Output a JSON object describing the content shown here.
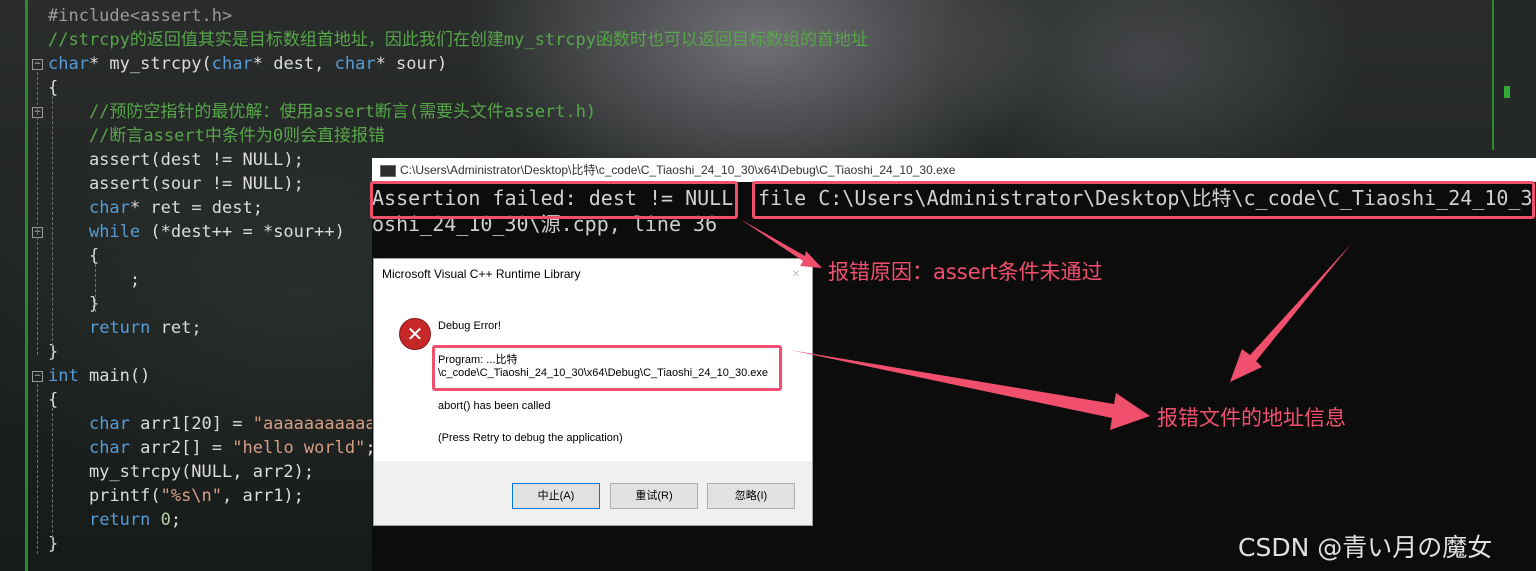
{
  "editor": {
    "lines": [
      [
        {
          "t": "#include<assert.h>",
          "c": "pp"
        }
      ],
      [
        {
          "t": "//strcpy的返回值其实是目标数组首地址，因此我们在创建my_strcpy函数时也可以返回目标数组的首地址",
          "c": "cm"
        }
      ],
      [
        {
          "t": "char",
          "c": "kw"
        },
        {
          "t": "* my_strcpy(",
          "c": "id"
        },
        {
          "t": "char",
          "c": "kw"
        },
        {
          "t": "* dest, ",
          "c": "id"
        },
        {
          "t": "char",
          "c": "kw"
        },
        {
          "t": "* sour)",
          "c": "id"
        }
      ],
      [
        {
          "t": "{",
          "c": "id"
        }
      ],
      [
        {
          "t": "    //预防空指针的最优解：使用assert断言(需要头文件assert.h)",
          "c": "cm"
        }
      ],
      [
        {
          "t": "    //断言assert中条件为0则会直接报错",
          "c": "cm"
        }
      ],
      [
        {
          "t": "    assert(dest != NULL);",
          "c": "id"
        }
      ],
      [
        {
          "t": "    assert(sour != NULL);",
          "c": "id"
        }
      ],
      [
        {
          "t": "    ",
          "c": "id"
        },
        {
          "t": "char",
          "c": "kw"
        },
        {
          "t": "* ret = dest;",
          "c": "id"
        }
      ],
      [
        {
          "t": "    ",
          "c": "id"
        },
        {
          "t": "while",
          "c": "kw"
        },
        {
          "t": " (*dest++ = *sour++)",
          "c": "id"
        }
      ],
      [
        {
          "t": "    {",
          "c": "id"
        }
      ],
      [
        {
          "t": "        ;",
          "c": "id"
        }
      ],
      [
        {
          "t": "    }",
          "c": "id"
        }
      ],
      [
        {
          "t": "    ",
          "c": "id"
        },
        {
          "t": "return",
          "c": "kw"
        },
        {
          "t": " ret;",
          "c": "id"
        }
      ],
      [
        {
          "t": "}",
          "c": "id"
        }
      ],
      [
        {
          "t": "int",
          "c": "kw"
        },
        {
          "t": " main()",
          "c": "id"
        }
      ],
      [
        {
          "t": "{",
          "c": "id"
        }
      ],
      [
        {
          "t": "    ",
          "c": "id"
        },
        {
          "t": "char",
          "c": "kw"
        },
        {
          "t": " arr1[20] = ",
          "c": "id"
        },
        {
          "t": "\"aaaaaaaaaaa\"",
          "c": "st"
        }
      ],
      [
        {
          "t": "    ",
          "c": "id"
        },
        {
          "t": "char",
          "c": "kw"
        },
        {
          "t": " arr2[] = ",
          "c": "id"
        },
        {
          "t": "\"hello world\"",
          "c": "st"
        },
        {
          "t": ";",
          "c": "id"
        }
      ],
      [
        {
          "t": "    my_strcpy(NULL, arr2);",
          "c": "id"
        }
      ],
      [
        {
          "t": "    printf(",
          "c": "id"
        },
        {
          "t": "\"%s\\n\"",
          "c": "st"
        },
        {
          "t": ", arr1);",
          "c": "id"
        }
      ],
      [
        {
          "t": "    ",
          "c": "id"
        },
        {
          "t": "return",
          "c": "kw"
        },
        {
          "t": " ",
          "c": "id"
        },
        {
          "t": "0",
          "c": "num"
        },
        {
          "t": ";",
          "c": "id"
        }
      ],
      [
        {
          "t": "}",
          "c": "id"
        }
      ]
    ]
  },
  "console": {
    "title": "C:\\Users\\Administrator\\Desktop\\比特\\c_code\\C_Tiaoshi_24_10_30\\x64\\Debug\\C_Tiaoshi_24_10_30.exe",
    "assert_msg": "Assertion failed: dest != NULL",
    "file_msg": "file C:\\Users\\Administrator\\Desktop\\比特\\c_code\\C_Tiaoshi_24_10_3",
    "line2": "oshi_24_10_30\\源.cpp, line 36"
  },
  "dialog": {
    "title": "Microsoft Visual C++ Runtime Library",
    "close": "×",
    "heading": "Debug Error!",
    "program_line1": "Program: ...比特",
    "program_line2": "\\c_code\\C_Tiaoshi_24_10_30\\x64\\Debug\\C_Tiaoshi_24_10_30.exe",
    "abort_msg": "abort() has been called",
    "hint": "(Press Retry to debug the application)",
    "buttons": {
      "abort": "中止(A)",
      "retry": "重试(R)",
      "ignore": "忽略(I)"
    }
  },
  "annotations": {
    "reason": "报错原因：assert条件未通过",
    "address": "报错文件的地址信息"
  },
  "watermark": "CSDN @青い月の魔女",
  "colors": {
    "annotation": "#f0506e",
    "comment": "#57a64a",
    "keyword": "#569cd6",
    "string": "#d69d85"
  }
}
